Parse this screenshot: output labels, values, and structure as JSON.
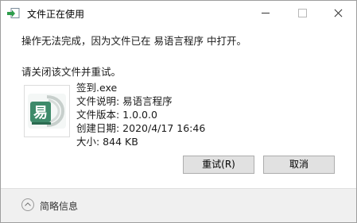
{
  "window": {
    "title": "文件正在使用"
  },
  "message": {
    "line1": "操作无法完成，因为文件已在 易语言程序 中打开。",
    "line2": "请关闭该文件并重试。"
  },
  "file": {
    "icon": "e-language-program-icon",
    "name": "签到.exe",
    "description": "文件说明: 易语言程序",
    "version": "文件版本: 1.0.0.0",
    "created": "创建日期: 2020/4/17 16:46",
    "size": "大小: 844 KB"
  },
  "buttons": {
    "retry": "重试(R)",
    "cancel": "取消"
  },
  "footer": {
    "toggle_label": "简略信息"
  },
  "colors": {
    "icon_green": "#3e8a6a",
    "footer_bg": "#f0f0f0",
    "button_bg": "#e1e1e1"
  }
}
